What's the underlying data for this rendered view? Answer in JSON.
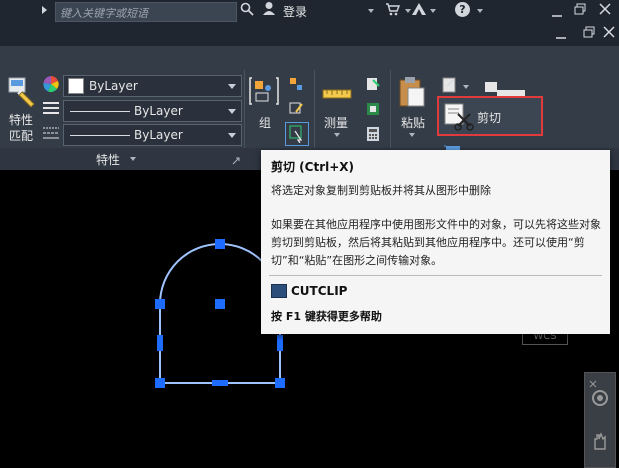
{
  "titlebar": {
    "search_placeholder": "键入关键字或短语",
    "login_label": "登录",
    "help_icon": "?"
  },
  "ribbon": {
    "match_properties_label_line1": "特性",
    "match_properties_label_line2": "匹配",
    "color_value": "ByLayer",
    "linetype_value": "ByLayer",
    "lineweight_value": "ByLayer",
    "properties_panel_label": "特性",
    "group_label": "组",
    "measure_label": "测量",
    "paste_label": "粘贴",
    "cut_label": "剪切"
  },
  "tooltip": {
    "title": "剪切 (Ctrl+X)",
    "short_desc": "将选定对象复制到剪贴板并将其从图形中删除",
    "long_desc": "如果要在其他应用程序中使用图形文件中的对象，可以先将这些对象剪切到剪贴板，然后将其粘贴到其他应用程序中。还可以使用“剪切”和“粘贴”在图形之间传输对象。",
    "command": "CUTCLIP",
    "help_text": "按 F1 键获得更多帮助"
  },
  "canvas": {
    "ucs_label": "WCS"
  },
  "colors": {
    "accent_highlight": "#e03a3a",
    "selection_grip": "#1e6bff",
    "shape_outline": "#9fc3ff"
  }
}
